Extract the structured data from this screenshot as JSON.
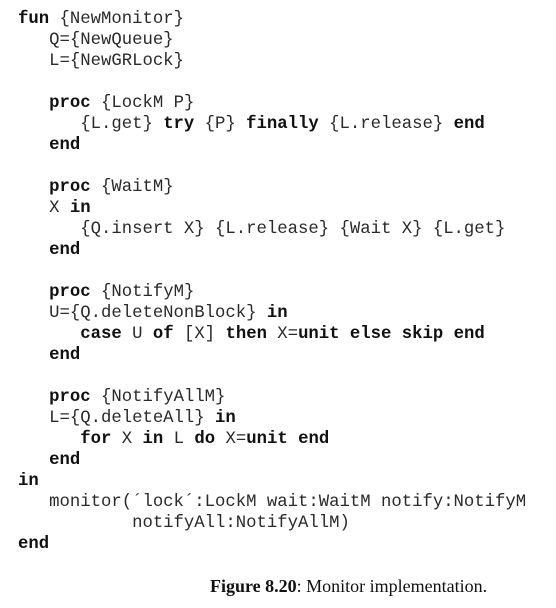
{
  "listing": {
    "lines": [
      [
        {
          "t": "fun",
          "k": true
        },
        {
          "t": " {NewMonitor}",
          "k": false
        }
      ],
      [
        {
          "t": "   Q={NewQueue}",
          "k": false
        }
      ],
      [
        {
          "t": "   L={NewGRLock}",
          "k": false
        }
      ],
      [],
      [
        {
          "t": "   ",
          "k": false
        },
        {
          "t": "proc",
          "k": true
        },
        {
          "t": " {LockM P}",
          "k": false
        }
      ],
      [
        {
          "t": "      {L.get} ",
          "k": false
        },
        {
          "t": "try",
          "k": true
        },
        {
          "t": " {P} ",
          "k": false
        },
        {
          "t": "finally",
          "k": true
        },
        {
          "t": " {L.release} ",
          "k": false
        },
        {
          "t": "end",
          "k": true
        }
      ],
      [
        {
          "t": "   ",
          "k": false
        },
        {
          "t": "end",
          "k": true
        }
      ],
      [],
      [
        {
          "t": "   ",
          "k": false
        },
        {
          "t": "proc",
          "k": true
        },
        {
          "t": " {WaitM}",
          "k": false
        }
      ],
      [
        {
          "t": "   X ",
          "k": false
        },
        {
          "t": "in",
          "k": true
        }
      ],
      [
        {
          "t": "      {Q.insert X} {L.release} {Wait X} {L.get}",
          "k": false
        }
      ],
      [
        {
          "t": "   ",
          "k": false
        },
        {
          "t": "end",
          "k": true
        }
      ],
      [],
      [
        {
          "t": "   ",
          "k": false
        },
        {
          "t": "proc",
          "k": true
        },
        {
          "t": " {NotifyM}",
          "k": false
        }
      ],
      [
        {
          "t": "   U={Q.deleteNonBlock} ",
          "k": false
        },
        {
          "t": "in",
          "k": true
        }
      ],
      [
        {
          "t": "      ",
          "k": false
        },
        {
          "t": "case",
          "k": true
        },
        {
          "t": " U ",
          "k": false
        },
        {
          "t": "of",
          "k": true
        },
        {
          "t": " [X] ",
          "k": false
        },
        {
          "t": "then",
          "k": true
        },
        {
          "t": " X=",
          "k": false
        },
        {
          "t": "unit else skip end",
          "k": true
        }
      ],
      [
        {
          "t": "   ",
          "k": false
        },
        {
          "t": "end",
          "k": true
        }
      ],
      [],
      [
        {
          "t": "   ",
          "k": false
        },
        {
          "t": "proc",
          "k": true
        },
        {
          "t": " {NotifyAllM}",
          "k": false
        }
      ],
      [
        {
          "t": "   L={Q.deleteAll} ",
          "k": false
        },
        {
          "t": "in",
          "k": true
        }
      ],
      [
        {
          "t": "      ",
          "k": false
        },
        {
          "t": "for",
          "k": true
        },
        {
          "t": " X ",
          "k": false
        },
        {
          "t": "in",
          "k": true
        },
        {
          "t": " L ",
          "k": false
        },
        {
          "t": "do",
          "k": true
        },
        {
          "t": " X=",
          "k": false
        },
        {
          "t": "unit end",
          "k": true
        }
      ],
      [
        {
          "t": "   ",
          "k": false
        },
        {
          "t": "end",
          "k": true
        }
      ],
      [
        {
          "t": "in",
          "k": true
        }
      ],
      [
        {
          "t": "   monitor(´lock´:LockM wait:WaitM notify:NotifyM",
          "k": false
        }
      ],
      [
        {
          "t": "           notifyAll:NotifyAllM)",
          "k": false
        }
      ],
      [
        {
          "t": "end",
          "k": true
        }
      ]
    ]
  },
  "caption": {
    "label": "Figure 8.20",
    "text": ": Monitor implementation."
  }
}
